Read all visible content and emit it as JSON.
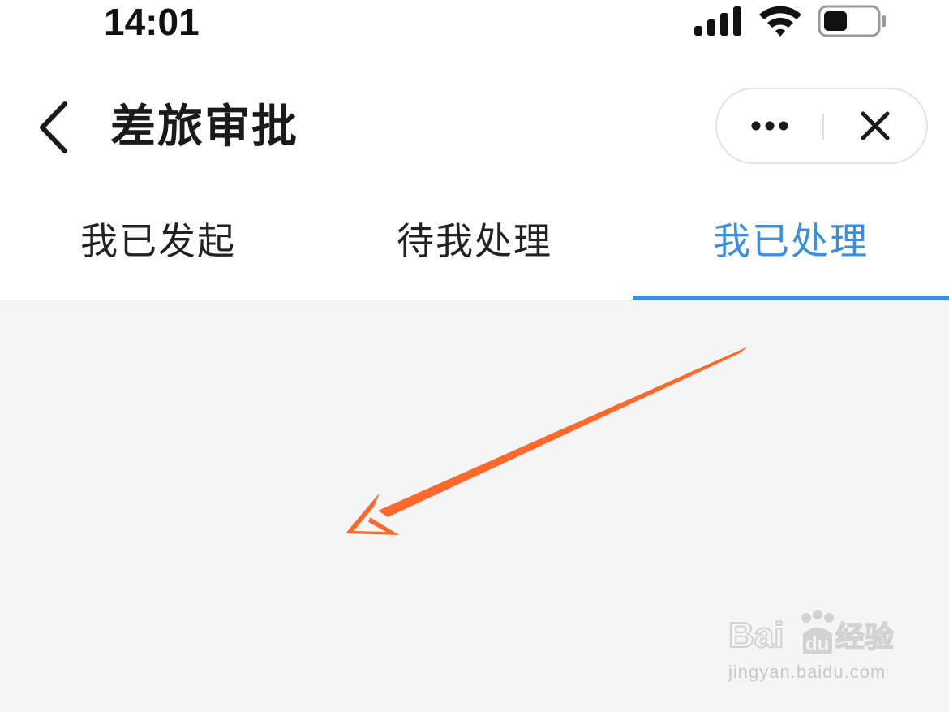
{
  "status_bar": {
    "time": "14:01",
    "icons": [
      "signal-icon",
      "wifi-icon",
      "battery-icon"
    ]
  },
  "header": {
    "title": "差旅审批",
    "back_icon": "chevron-left-icon",
    "more_icon": "more-dots-icon",
    "close_icon": "close-icon"
  },
  "tabs": [
    {
      "label": "我已发起",
      "active": false
    },
    {
      "label": "待我处理",
      "active": false
    },
    {
      "label": "我已处理",
      "active": true
    }
  ],
  "annotation": {
    "type": "arrow",
    "color": "#ff6a2c"
  },
  "watermark": {
    "logo_text": "Bai du 经验",
    "url": "jingyan.baidu.com"
  },
  "colors": {
    "accent": "#3d8fdc",
    "background": "#f5f5f5",
    "arrow": "#ff6a2c"
  }
}
